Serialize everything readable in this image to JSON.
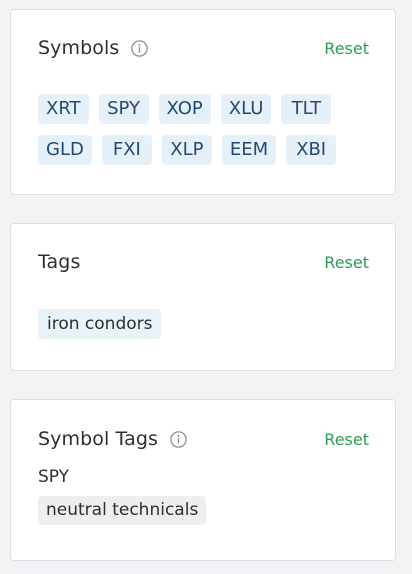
{
  "symbols_panel": {
    "title": "Symbols",
    "info_icon": "info-circle-icon",
    "reset_label": "Reset",
    "chips": [
      "XRT",
      "SPY",
      "XOP",
      "XLU",
      "TLT",
      "GLD",
      "FXI",
      "XLP",
      "EEM",
      "XBI"
    ]
  },
  "tags_panel": {
    "title": "Tags",
    "reset_label": "Reset",
    "chips": [
      "iron condors"
    ]
  },
  "symbol_tags_panel": {
    "title": "Symbol Tags",
    "info_icon": "info-circle-icon",
    "reset_label": "Reset",
    "symbol": "SPY",
    "tag": "neutral technicals"
  },
  "colors": {
    "accent_reset": "#2e9b55",
    "chip_bg": "#e6f0f8",
    "chip_text": "#234a75",
    "symbol_tag_bg": "#eeeeee"
  }
}
